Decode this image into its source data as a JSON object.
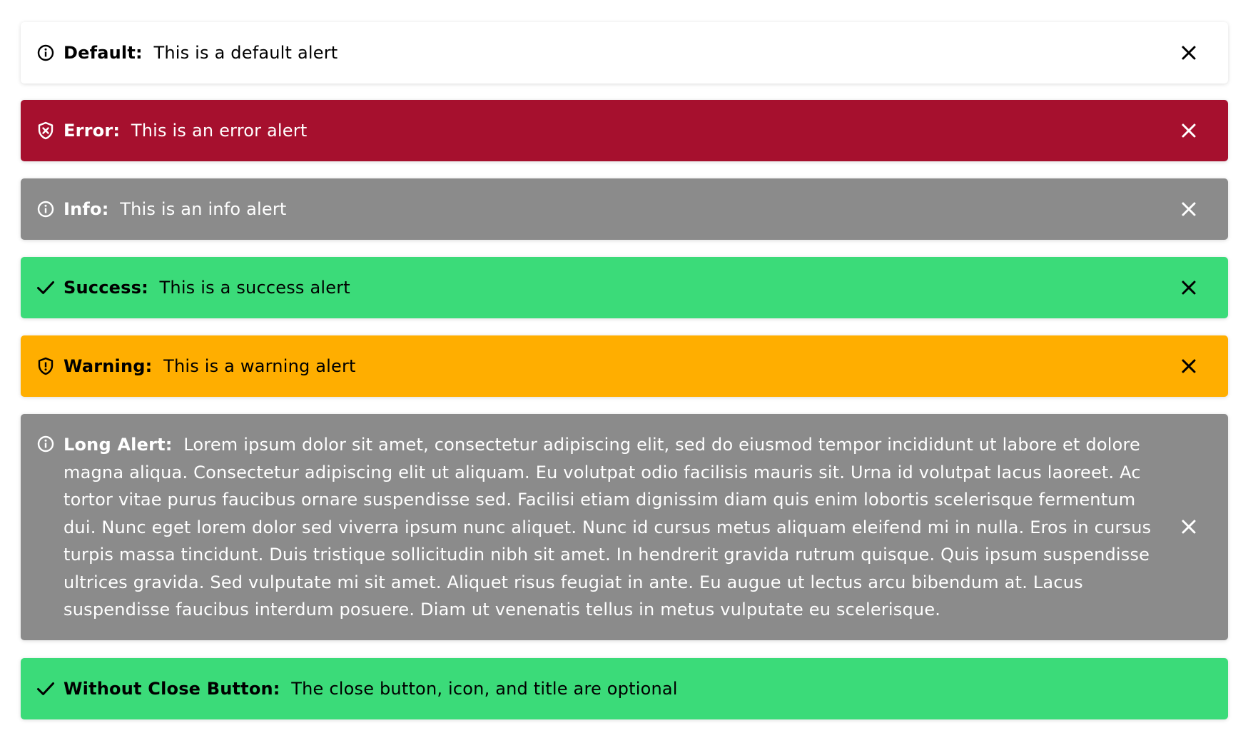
{
  "alerts": [
    {
      "variant": "default",
      "icon": "info-circle-icon",
      "title": "Default:",
      "message": "This is a default alert",
      "background": "#ffffff",
      "text_color": "#000000",
      "closable": true
    },
    {
      "variant": "error",
      "icon": "shield-x-icon",
      "title": "Error:",
      "message": "This is an error alert",
      "background": "#a6102e",
      "text_color": "#ffffff",
      "closable": true
    },
    {
      "variant": "info",
      "icon": "info-circle-icon",
      "title": "Info:",
      "message": "This is an info alert",
      "background": "#8b8b8b",
      "text_color": "#ffffff",
      "closable": true
    },
    {
      "variant": "success",
      "icon": "check-icon",
      "title": "Success:",
      "message": "This is a success alert",
      "background": "#3bdb79",
      "text_color": "#000000",
      "closable": true
    },
    {
      "variant": "warning",
      "icon": "shield-alert-icon",
      "title": "Warning:",
      "message": "This is a warning alert",
      "background": "#ffae00",
      "text_color": "#000000",
      "closable": true
    },
    {
      "variant": "info-long",
      "icon": "info-circle-icon",
      "title": "Long Alert:",
      "message": "Lorem ipsum dolor sit amet, consectetur adipiscing elit, sed do eiusmod tempor incididunt ut labore et dolore magna aliqua. Consectetur adipiscing elit ut aliquam. Eu volutpat odio facilisis mauris sit. Urna id volutpat lacus laoreet. Ac tortor vitae purus faucibus ornare suspendisse sed. Facilisi etiam dignissim diam quis enim lobortis scelerisque fermentum dui. Nunc eget lorem dolor sed viverra ipsum nunc aliquet. Nunc id cursus metus aliquam eleifend mi in nulla. Eros in cursus turpis massa tincidunt. Duis tristique sollicitudin nibh sit amet. In hendrerit gravida rutrum quisque. Quis ipsum suspendisse ultrices gravida. Sed vulputate mi sit amet. Aliquet risus feugiat in ante. Eu augue ut lectus arcu bibendum at. Lacus suspendisse faucibus interdum posuere. Diam ut venenatis tellus in metus vulputate eu scelerisque.",
      "background": "#8b8b8b",
      "text_color": "#ffffff",
      "closable": true
    },
    {
      "variant": "success",
      "icon": "check-icon",
      "title": "Without Close Button:",
      "message": "The close button, icon, and title are optional",
      "background": "#3bdb79",
      "text_color": "#000000",
      "closable": false
    }
  ]
}
